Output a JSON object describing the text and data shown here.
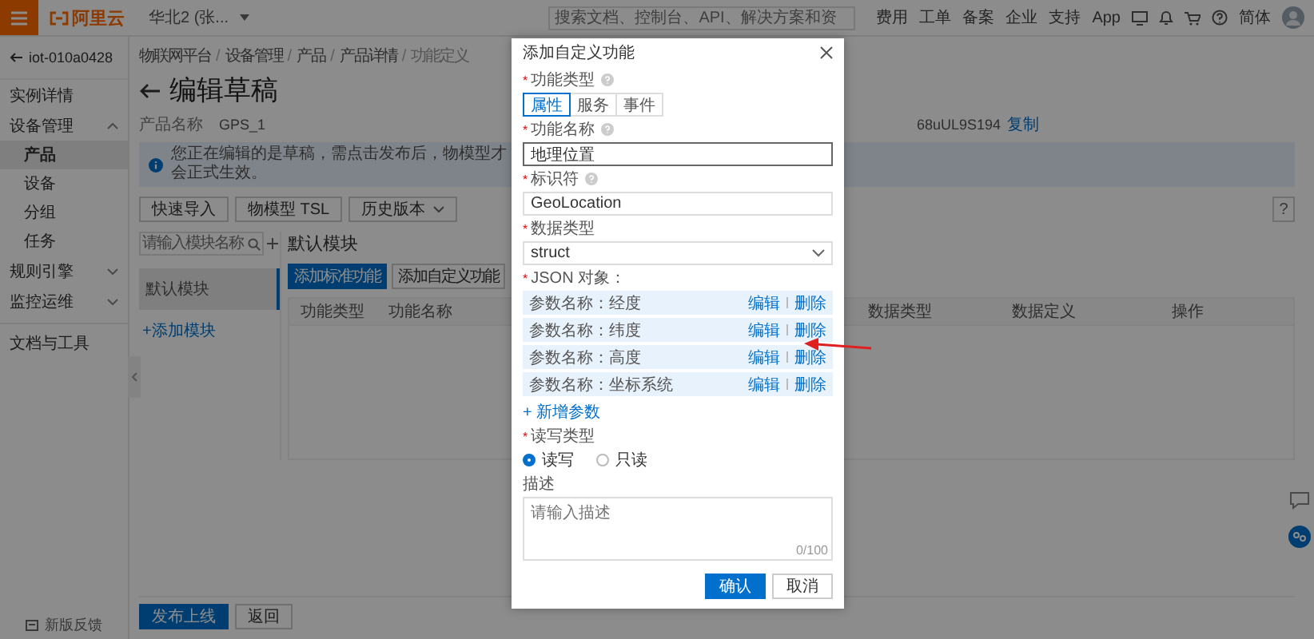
{
  "header": {
    "logo": "阿里云",
    "region": "华北2 (张...",
    "search_placeholder": "搜索文档、控制台、API、解决方案和资",
    "nav": [
      "费用",
      "工单",
      "备案",
      "企业",
      "支持",
      "App"
    ],
    "language": "简体"
  },
  "sidebar": {
    "instance": "iot-010a0428",
    "items": [
      {
        "label": "实例详情",
        "kind": "item",
        "selected": false
      },
      {
        "label": "设备管理",
        "kind": "group",
        "selected": false,
        "expanded": true,
        "children": [
          {
            "label": "产品",
            "selected": true
          },
          {
            "label": "设备",
            "selected": false
          },
          {
            "label": "分组",
            "selected": false
          },
          {
            "label": "任务",
            "selected": false
          }
        ]
      },
      {
        "label": "规则引擎",
        "kind": "group",
        "selected": false,
        "expanded": false
      },
      {
        "label": "监控运维",
        "kind": "group",
        "selected": false,
        "expanded": false
      },
      {
        "label": "文档与工具",
        "kind": "item",
        "selected": false
      }
    ],
    "feedback": "新版反馈"
  },
  "page": {
    "breadcrumb": [
      "物联网平台",
      "设备管理",
      "产品",
      "产品详情",
      "功能定义"
    ],
    "breadcrumb_separator": "/",
    "title": "编辑草稿",
    "product": {
      "label": "产品名称",
      "value": "GPS_1",
      "key": "68uUL9S194",
      "copy": "复制"
    },
    "notice": "您正在编辑的是草稿，需点击发布后，物模型才会正式生效。",
    "toolbar": [
      {
        "label": "快速导入",
        "kind": "button"
      },
      {
        "label": "物模型 TSL",
        "kind": "button"
      },
      {
        "label": "历史版本",
        "kind": "dropdown"
      }
    ],
    "help_button": "?",
    "modules": {
      "search_placeholder": "请输入模块名称",
      "items": [
        {
          "label": "默认模块",
          "selected": true
        }
      ],
      "add": "+添加模块"
    },
    "panel": {
      "title": "默认模块",
      "actions": [
        {
          "label": "添加标准功能",
          "kind": "primary"
        },
        {
          "label": "添加自定义功能",
          "kind": "default"
        }
      ],
      "columns": [
        "功能类型",
        "功能名称",
        "数据类型",
        "数据定义",
        "操作"
      ]
    },
    "footer_actions": [
      {
        "label": "发布上线",
        "kind": "primary"
      },
      {
        "label": "返回",
        "kind": "default"
      }
    ]
  },
  "dialog": {
    "title": "添加自定义功能",
    "function_type": {
      "mark": "*",
      "label": "功能类型",
      "help": true,
      "options": [
        {
          "label": "属性",
          "selected": true
        },
        {
          "label": "服务",
          "selected": false
        },
        {
          "label": "事件",
          "selected": false
        }
      ]
    },
    "name": {
      "mark": "*",
      "label": "功能名称",
      "help": true,
      "value": "地理位置",
      "focused": true
    },
    "identifier": {
      "mark": "*",
      "label": "标识符",
      "help": true,
      "value": "GeoLocation",
      "focused": false
    },
    "data_type": {
      "mark": "*",
      "label": "数据类型",
      "value": "struct"
    },
    "json": {
      "mark": "*",
      "label": "JSON 对象：",
      "params": [
        {
          "name": "参数名称：经度",
          "edit": "编辑",
          "delete": "删除"
        },
        {
          "name": "参数名称：纬度",
          "edit": "编辑",
          "delete": "删除"
        },
        {
          "name": "参数名称：高度",
          "edit": "编辑",
          "delete": "删除"
        },
        {
          "name": "参数名称：坐标系统",
          "edit": "编辑",
          "delete": "删除"
        }
      ],
      "add": "+ 新增参数"
    },
    "access": {
      "mark": "*",
      "label": "读写类型",
      "options": [
        {
          "label": "读写",
          "selected": true
        },
        {
          "label": "只读",
          "selected": false
        }
      ]
    },
    "description": {
      "label": "描述",
      "placeholder": "请输入描述",
      "counter": "0/100"
    },
    "buttons": [
      {
        "label": "确认",
        "kind": "primary"
      },
      {
        "label": "取消",
        "kind": "default"
      }
    ]
  }
}
